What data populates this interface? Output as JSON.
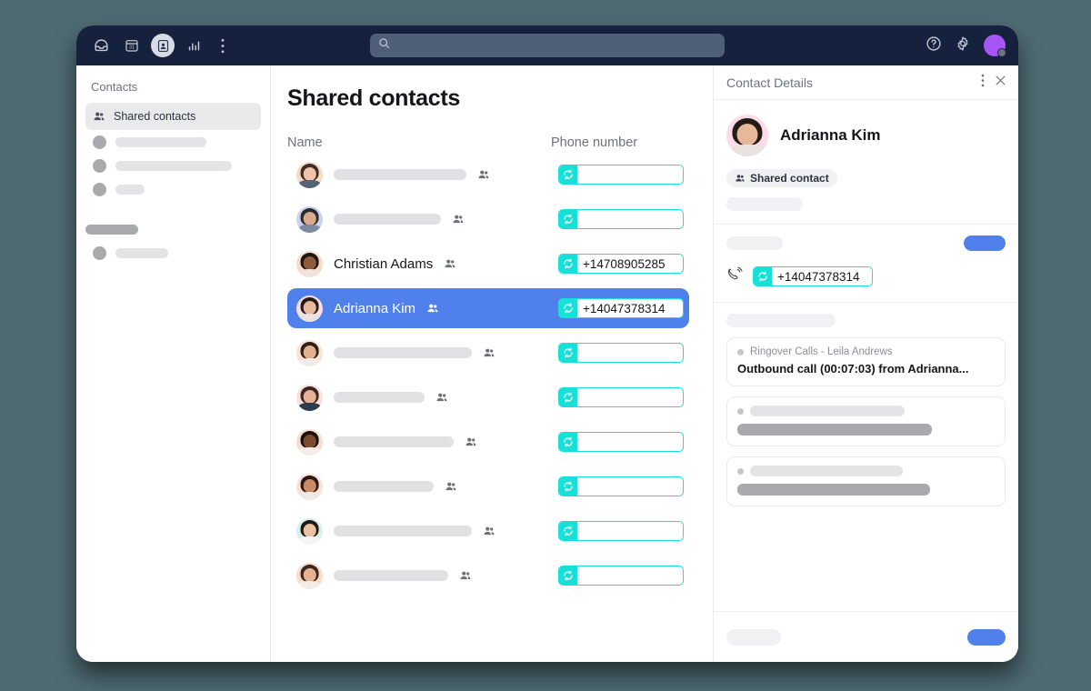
{
  "topbar": {
    "icons": [
      {
        "name": "inbox-icon",
        "label": "Inbox"
      },
      {
        "name": "calendar-icon",
        "label": "Calendar",
        "day": "31"
      },
      {
        "name": "contacts-icon",
        "label": "Contacts",
        "active": true
      },
      {
        "name": "analytics-icon",
        "label": "Analytics"
      },
      {
        "name": "more-vertical-icon",
        "label": "More"
      }
    ],
    "search": {
      "value": "",
      "placeholder": ""
    },
    "help_label": "Help",
    "settings_label": "Settings",
    "avatar_color": "#a855f7",
    "status_color": "#6b7280"
  },
  "sidebar": {
    "title": "Contacts",
    "items": [
      {
        "label": "Shared contacts",
        "icon": "group-icon",
        "selected": true
      }
    ],
    "skeleton_rows": [
      {
        "width": 100
      },
      {
        "width": 128
      },
      {
        "width": 32
      }
    ],
    "group_bar_width": 58,
    "skeleton_rows_2": [
      {
        "width": 58
      }
    ]
  },
  "main": {
    "title": "Shared contacts",
    "columns": {
      "name": "Name",
      "phone": "Phone number"
    },
    "rows": [
      {
        "name": "",
        "name_skeleton_width": 146,
        "phone": "",
        "phone_width": 138,
        "avatar": {
          "hair": "#3a2f2b",
          "face": "#f0c4a8",
          "body": "#566274",
          "bg": "#f7d9c4"
        },
        "selected": false
      },
      {
        "name": "",
        "name_skeleton_width": 118,
        "phone": "",
        "phone_width": 138,
        "avatar": {
          "hair": "#2b2a30",
          "face": "#d8a98b",
          "body": "#7d8aa0",
          "bg": "#ccd3e8"
        },
        "selected": false
      },
      {
        "name": "Christian Adams",
        "name_skeleton_width": 0,
        "phone": "+14708905285",
        "phone_width": 138,
        "avatar": {
          "hair": "#1c1512",
          "face": "#8d5a3e",
          "body": "#f0e3d8",
          "bg": "#f8dbc9"
        },
        "selected": false
      },
      {
        "name": "Adrianna Kim",
        "name_skeleton_width": 0,
        "phone": "+14047378314",
        "phone_width": 138,
        "avatar": {
          "hair": "#241a18",
          "face": "#e8b89a",
          "body": "#e8e3e0",
          "bg": "#fbdde8"
        },
        "selected": true
      },
      {
        "name": "",
        "name_skeleton_width": 152,
        "phone": "",
        "phone_width": 138,
        "avatar": {
          "hair": "#2e201a",
          "face": "#e2b08c",
          "body": "#f2ece6",
          "bg": "#fae2d4"
        },
        "selected": false
      },
      {
        "name": "",
        "name_skeleton_width": 100,
        "phone": "",
        "phone_width": 138,
        "avatar": {
          "hair": "#3a2622",
          "face": "#e6b094",
          "body": "#2f3b4e",
          "bg": "#fadfdc"
        },
        "selected": false
      },
      {
        "name": "",
        "name_skeleton_width": 132,
        "phone": "",
        "phone_width": 138,
        "avatar": {
          "hair": "#1a1210",
          "face": "#7d4c30",
          "body": "#f3eee9",
          "bg": "#f6ddcf"
        },
        "selected": false
      },
      {
        "name": "",
        "name_skeleton_width": 110,
        "phone": "",
        "phone_width": 138,
        "avatar": {
          "hair": "#2a1a14",
          "face": "#c98b66",
          "body": "#eceae7",
          "bg": "#fbdfd9"
        },
        "selected": false
      },
      {
        "name": "",
        "name_skeleton_width": 152,
        "phone": "",
        "phone_width": 138,
        "avatar": {
          "hair": "#1e1a18",
          "face": "#e8c0a2",
          "body": "#f5f5f5",
          "bg": "#d8f0ea"
        },
        "selected": false
      },
      {
        "name": "",
        "name_skeleton_width": 126,
        "phone": "",
        "phone_width": 138,
        "avatar": {
          "hair": "#3a281e",
          "face": "#e6b392",
          "body": "#f1ece7",
          "bg": "#fbdcc8"
        },
        "selected": false
      }
    ]
  },
  "details": {
    "header_title": "Contact Details",
    "more_label": "More options",
    "close_label": "Close",
    "contact_name": "Adrianna Kim",
    "shared_badge": "Shared contact",
    "phone_number": "+14047378314",
    "activity": {
      "source": "Ringover Calls - Leila Andrews",
      "summary": "Outbound call  (00:07:03) from Adrianna..."
    },
    "skeleton_cards": [
      {
        "light_width": 170,
        "dark_width": 214
      },
      {
        "light_width": 168,
        "dark_width": 212
      }
    ]
  },
  "colors": {
    "accent_blue": "#4f80ec",
    "sync_teal": "#18e0d8",
    "topbar_navy": "#16213d",
    "page_bg": "#4e6b73"
  }
}
